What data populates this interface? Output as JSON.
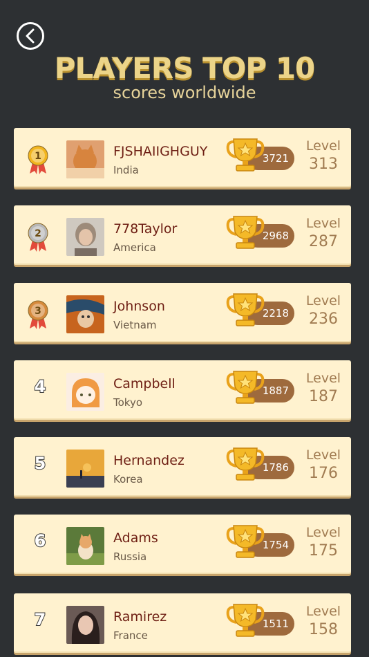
{
  "header": {
    "title": "PLAYERS TOP 10",
    "subtitle": "scores worldwide"
  },
  "level_label": "Level",
  "colors": {
    "background": "#2d3033",
    "row_bg": "#fff2cf",
    "title": "#ecd489",
    "name": "#6e1f14",
    "score_pill": "#9e6a3d",
    "trophy": "#f4b928",
    "gold_medal": "#f2b51e",
    "silver_medal": "#b7b7b7",
    "bronze_medal": "#d68a3c"
  },
  "players": [
    {
      "rank": "1",
      "medal": "gold",
      "name": "FJSHAIIGHGUY",
      "country": "India",
      "score": "3721",
      "level": "313",
      "avatar": "orange-cat-avatar"
    },
    {
      "rank": "2",
      "medal": "silver",
      "name": "778Taylor",
      "country": "America",
      "score": "2968",
      "level": "287",
      "avatar": "person-avatar"
    },
    {
      "rank": "3",
      "medal": "bronze",
      "name": "Johnson",
      "country": "Vietnam",
      "score": "2218",
      "level": "236",
      "avatar": "scream-painting-avatar"
    },
    {
      "rank": "4",
      "medal": "",
      "name": "Campbell",
      "country": "Tokyo",
      "score": "1887",
      "level": "187",
      "avatar": "anime-girl-avatar"
    },
    {
      "rank": "5",
      "medal": "",
      "name": "Hernandez",
      "country": "Korea",
      "score": "1786",
      "level": "176",
      "avatar": "sunset-album-avatar"
    },
    {
      "rank": "6",
      "medal": "",
      "name": "Adams",
      "country": "Russia",
      "score": "1754",
      "level": "175",
      "avatar": "kitten-avatar"
    },
    {
      "rank": "7",
      "medal": "",
      "name": "Ramirez",
      "country": "France",
      "score": "1511",
      "level": "158",
      "avatar": "woman-portrait-avatar"
    }
  ]
}
